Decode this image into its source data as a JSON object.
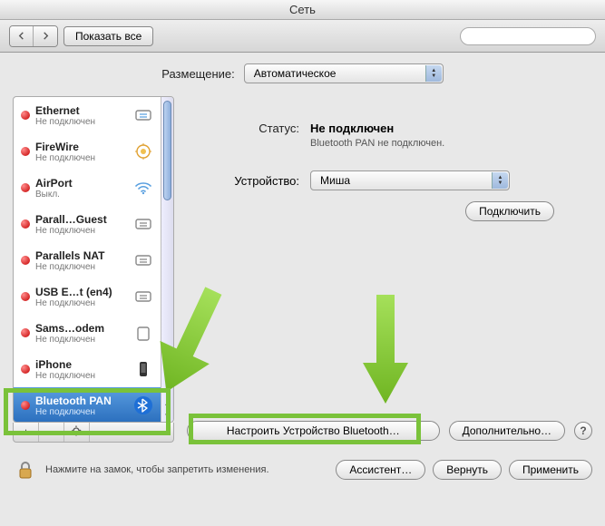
{
  "window": {
    "title": "Сеть"
  },
  "toolbar": {
    "show_all": "Показать все"
  },
  "location": {
    "label": "Размещение:",
    "value": "Автоматическое"
  },
  "sidebar": {
    "items": [
      {
        "name": "Ethernet",
        "status": "Не подключен"
      },
      {
        "name": "FireWire",
        "status": "Не подключен"
      },
      {
        "name": "AirPort",
        "status": "Выкл."
      },
      {
        "name": "Parall…Guest",
        "status": "Не подключен"
      },
      {
        "name": "Parallels NAT",
        "status": "Не подключен"
      },
      {
        "name": "USB E…t (en4)",
        "status": "Не подключен"
      },
      {
        "name": "Sams…odem",
        "status": "Не подключен"
      },
      {
        "name": "iPhone",
        "status": "Не подключен"
      },
      {
        "name": "Bluetooth PAN",
        "status": "Не подключен"
      }
    ]
  },
  "detail": {
    "status_label": "Статус:",
    "status_value": "Не подключен",
    "status_sub": "Bluetooth PAN не подключен.",
    "device_label": "Устройство:",
    "device_value": "Миша",
    "connect_btn": "Подключить",
    "configure_bt": "Настроить Устройство Bluetooth…",
    "advanced": "Дополнительно…"
  },
  "footer": {
    "lock_text": "Нажмите на замок, чтобы запретить изменения.",
    "assistant": "Ассистент…",
    "revert": "Вернуть",
    "apply": "Применить"
  }
}
